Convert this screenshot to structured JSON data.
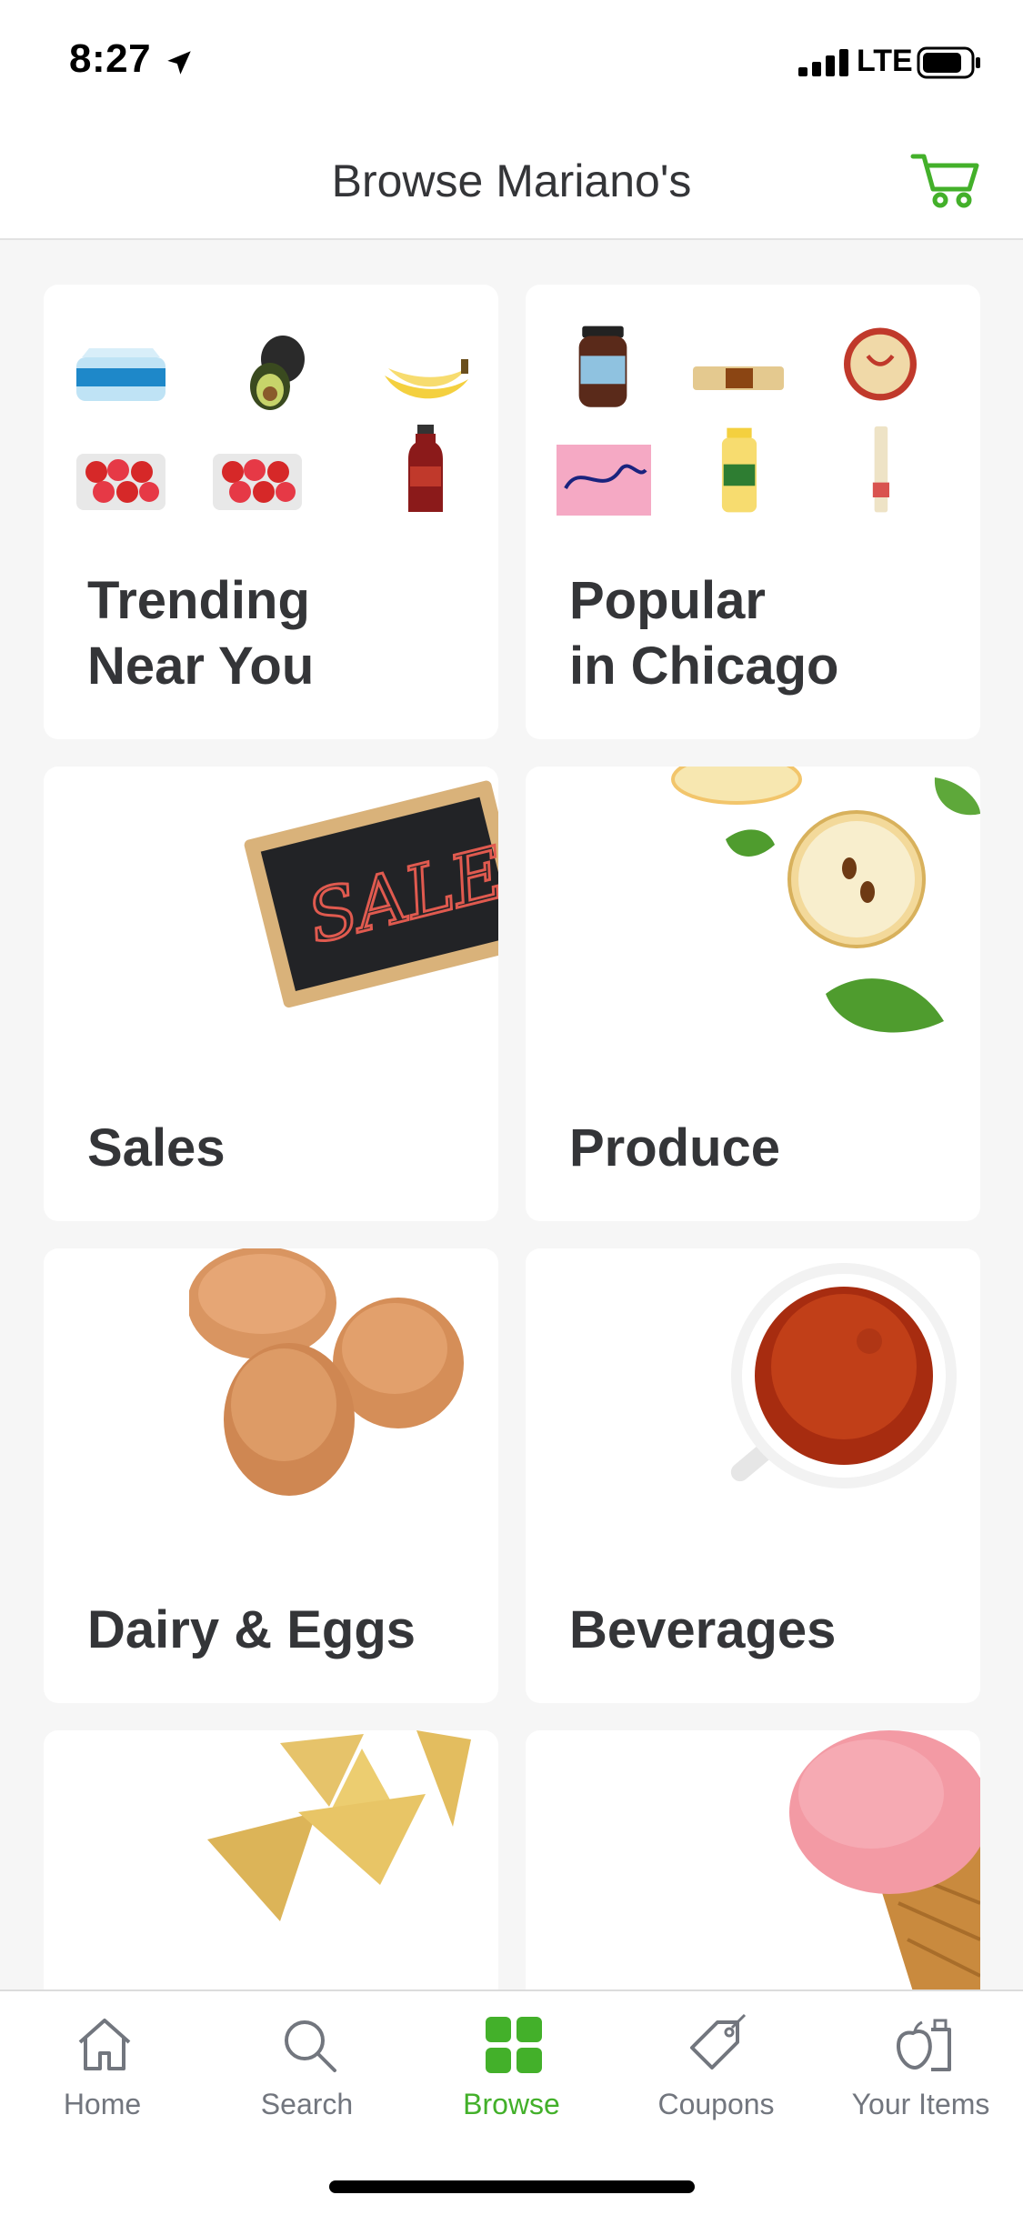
{
  "status_bar": {
    "time": "8:27",
    "network": "LTE"
  },
  "header": {
    "title": "Browse Mariano's"
  },
  "colors": {
    "accent": "#43b02a",
    "text": "#343538",
    "muted": "#72767e"
  },
  "categories": [
    {
      "label": "Trending\nNear You",
      "art": "product-thumbnails"
    },
    {
      "label": "Popular\nin Chicago",
      "art": "product-thumbnails"
    },
    {
      "label": "Sales",
      "art": "sale-chalkboard",
      "art_text": "SALE"
    },
    {
      "label": "Produce",
      "art": "apples-and-leaves"
    },
    {
      "label": "Dairy & Eggs",
      "art": "eggs"
    },
    {
      "label": "Beverages",
      "art": "cup-of-tea"
    },
    {
      "label": "",
      "art": "tortilla-chips"
    },
    {
      "label": "",
      "art": "ice-cream-cone"
    }
  ],
  "tabs": [
    {
      "label": "Home",
      "icon": "home-icon"
    },
    {
      "label": "Search",
      "icon": "search-icon"
    },
    {
      "label": "Browse",
      "icon": "grid-icon",
      "active": true
    },
    {
      "label": "Coupons",
      "icon": "tag-icon"
    },
    {
      "label": "Your Items",
      "icon": "groceries-icon"
    }
  ]
}
